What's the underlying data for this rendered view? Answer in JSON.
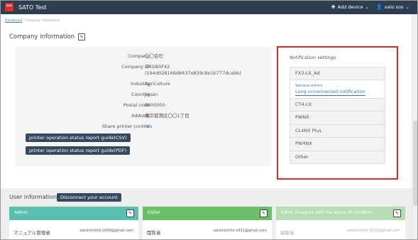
{
  "header": {
    "logo_text": "SOS",
    "app_title": "SATO Test",
    "add_device_label": "Add device",
    "user_label": "sato sos"
  },
  "breadcrumb": {
    "home": "Dashboard",
    "separator": "/",
    "current": "Company information"
  },
  "company": {
    "section_title": "Company information",
    "rows": [
      {
        "label": "Company",
        "value": "〇〇会社"
      },
      {
        "label": "Company ID",
        "value": "ORGB0F42",
        "value2": "(194d028166d8437e839c8e1b777dcabb)"
      },
      {
        "label": "Industry",
        "value": "Agriculture"
      },
      {
        "label": "Country",
        "value": "Japan"
      },
      {
        "label": "Postal code",
        "value": "0000000"
      },
      {
        "label": "Address",
        "value": "東京都港区〇〇1丁目"
      },
      {
        "label": "Share printer control",
        "value": "Yes"
      }
    ],
    "btn_csv": "printer operation status report guide(CSV)",
    "btn_pdf": "printer operation status report guide(PDF)"
  },
  "notifications": {
    "title": "Notification settings",
    "first_item": "FX3-LX_Ad",
    "serious": "Serious errors",
    "long_unconnected": "Long unconnected notification",
    "items": [
      "CT4-LX",
      "PWNX",
      "CL4NX Plus",
      "PW4NX",
      "Other"
    ]
  },
  "users": {
    "title": "User information",
    "disconnect_label": "Disconnect your account",
    "cards": [
      {
        "role": "Admin",
        "user": "マニュアル管理者",
        "email": "satomichihir.o009@gmail.com",
        "color": "#5bbfb0"
      },
      {
        "role": "Editor",
        "user": "閲覧者",
        "email": "satomichihir.o011@gmail.com",
        "color": "#6abf69"
      },
      {
        "role": "Editor    Disagree with the terms of condition",
        "user": "編集者",
        "email": "satomichihir.o010@gmail.com",
        "color": "#b6dcb4"
      }
    ]
  },
  "colors": {
    "nav": "#2c3e50",
    "highlight": "#d42a2a",
    "link": "#337ab7"
  }
}
